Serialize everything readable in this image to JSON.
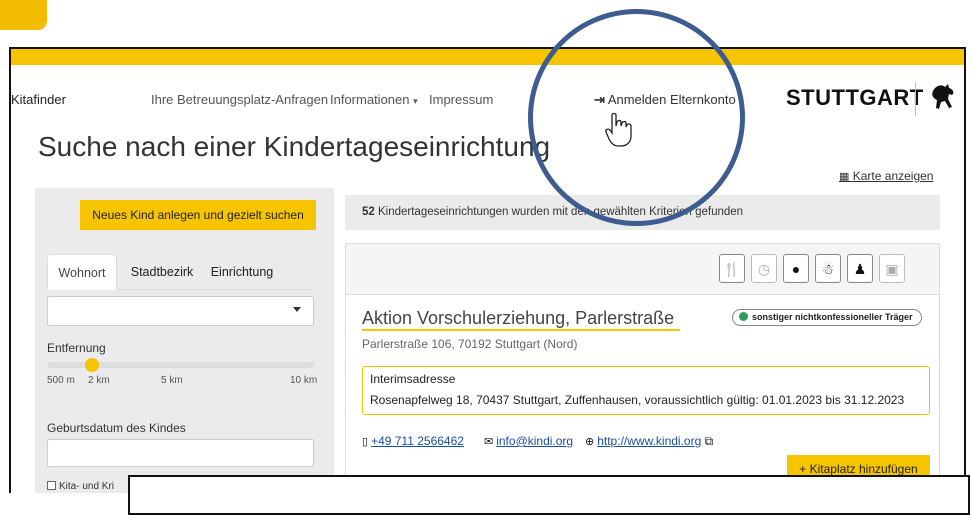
{
  "nav": {
    "brand": "Kitafinder",
    "requests": "Ihre Betreuungsplatz-Anfragen",
    "info": "Informationen",
    "imprint": "Impressum",
    "login": "Anmelden Elternkonto",
    "logo": "STUTTGART"
  },
  "page": {
    "title": "Suche nach einer Kindertageseinrichtung",
    "map_link": "Karte anzeigen"
  },
  "filters": {
    "new_child_button": "Neues Kind anlegen und gezielt suchen",
    "tabs": [
      "Wohnort",
      "Stadtbezirk",
      "Einrichtung"
    ],
    "select_value": "",
    "distance_label": "Entfernung",
    "distance_ticks": [
      "500 m",
      "2 km",
      "5 km",
      "10 km"
    ],
    "distance_selected": "2 km",
    "birthdate_label": "Geburtsdatum des Kindes",
    "birthdate_value": "",
    "kita_checkbox_label": "Kita- und Kri"
  },
  "results": {
    "count": "52",
    "banner_text": "Kindertageseinrichtungen wurden mit den gewählten Kriterien gefunden",
    "toolbar_icons": [
      "cutlery-icon",
      "clock-outline-icon",
      "clock-filled-icon",
      "baby-icon",
      "child-icon",
      "person-board-icon"
    ],
    "facility": {
      "name": "Aktion Vorschulerziehung, Parlerstraße",
      "address": "Parlerstraße 106, 70192 Stuttgart (Nord)",
      "badge": "sonstiger nichtkonfessioneller Träger",
      "badge_color": "#2e9e5a",
      "interim_title": "Interimsadresse",
      "interim_address": "Rosenapfelweg 18, 70437 Stuttgart, Zuffenhausen, voraussichtlich gültig: 01.01.2023 bis 31.12.2023",
      "phone": "+49 711 2566462",
      "email": "info@kindi.org",
      "website": "http://www.kindi.org",
      "add_button": "+ Kitaplatz hinzufügen"
    }
  },
  "colors": {
    "accent": "#f6c400",
    "annotation_circle": "#3d5c8f",
    "link": "#1a4fa0"
  }
}
